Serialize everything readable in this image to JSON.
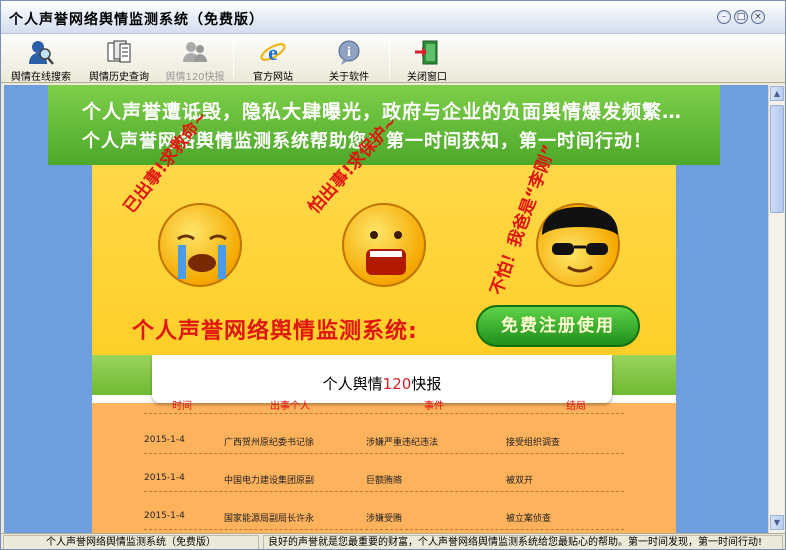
{
  "window": {
    "title": "个人声誉网络舆情监测系统（免费版）",
    "controls": {
      "minimize": "–",
      "restore": "□",
      "close": "×"
    }
  },
  "toolbar": [
    {
      "label": "舆情在线搜索",
      "icon": "user-search-icon"
    },
    {
      "label": "舆情历史查询",
      "icon": "history-documents-icon"
    },
    {
      "label": "舆情120快报",
      "icon": "users-bulletin-icon",
      "disabled": true
    },
    {
      "label": "官方网站",
      "icon": "ie-browser-icon"
    },
    {
      "label": "关于软件",
      "icon": "info-icon"
    },
    {
      "label": "关闭窗口",
      "icon": "exit-door-icon"
    }
  ],
  "banner": {
    "line1": "个人声誉遭诋毁，隐私大肆曝光，政府与企业的负面舆情爆发频繁…",
    "line2": "个人声誉网络舆情监测系统帮助您：第一时间获知，第一时间行动！",
    "face1_text": "已出事!求救命~",
    "face2_text": "怕出事!求保护~",
    "face3_text": "不怕！我爸是“李刚”",
    "brand_text": "个人声誉网络舆情监测系统:",
    "register_button": "免费注册使用"
  },
  "news": {
    "title_prefix": "个人舆情",
    "title_num": "120",
    "title_suffix": "快报",
    "columns": [
      "时间",
      "出事个人",
      "事件",
      "结局"
    ],
    "rows": [
      [
        "2015-1-4",
        "广西贺州原纪委书记徐",
        "涉嫌严重违纪违法",
        "接受组织调查"
      ],
      [
        "2015-1-4",
        "中国电力建设集团原副",
        "巨额贿赂",
        "被双开"
      ],
      [
        "2015-1-4",
        "国家能源局副局长许永",
        "涉嫌受贿",
        "被立案侦查"
      ]
    ]
  },
  "status": {
    "left": "个人声誉网络舆情监测系统（免费版）",
    "right": "良好的声誉就是您最重要的财富，个人声誉网络舆情监测系统给您最贴心的帮助。第一时间发现，第一时间行动!"
  },
  "colors": {
    "ribbon": "#4da82a",
    "red_text": "#e0150e",
    "yellow_bg": "#ffd84a",
    "orange_bg": "#ffb25c",
    "outer_bg": "#6d9ede"
  }
}
